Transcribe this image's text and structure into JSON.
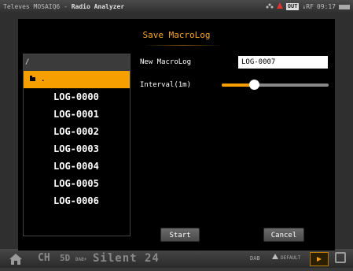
{
  "statusbar": {
    "brand": "Televes MOSAIQ6",
    "separator": " - ",
    "app": "Radio Analyzer",
    "out_badge": "OUT",
    "rf_label": "↓RF",
    "clock": "09:17"
  },
  "bottombar": {
    "channel_label": "CH",
    "channel_value": "5D",
    "band": "DAB+",
    "service": "Silent 24",
    "mode": "DAB",
    "preset": "DEFAULT"
  },
  "dialog": {
    "title": "Save MacroLog",
    "path": "/",
    "folder_entry": ".",
    "files": [
      "LOG-0000",
      "LOG-0001",
      "LOG-0002",
      "LOG-0003",
      "LOG-0004",
      "LOG-0005",
      "LOG-0006"
    ],
    "name_label": "New MacroLog",
    "name_value": "LOG-0007",
    "interval_label": "Interval(1m)",
    "interval_fraction": 0.3,
    "start_label": "Start",
    "cancel_label": "Cancel"
  },
  "colors": {
    "accent": "#f5a000",
    "title": "#f5a623",
    "background": "#000000"
  }
}
